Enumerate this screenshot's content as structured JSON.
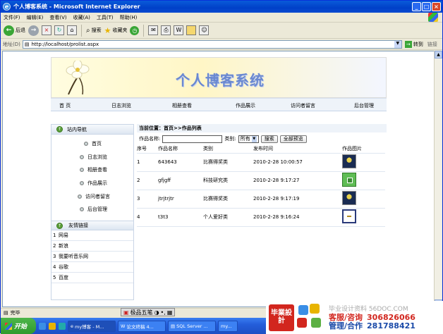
{
  "window": {
    "title": "个人博客系统 - Microsoft Internet Explorer",
    "min": "_",
    "max": "□",
    "close": "×"
  },
  "menu": [
    "文件(F)",
    "编辑(E)",
    "查看(V)",
    "收藏(A)",
    "工具(T)",
    "帮助(H)"
  ],
  "toolbar": {
    "back": "后退",
    "search": "搜索",
    "favorites": "收藏夹"
  },
  "address": {
    "label": "地址(D)",
    "url": "http://localhost/prolist.aspx",
    "go": "转到",
    "links": "链接"
  },
  "site": {
    "title": "个人博客系统",
    "nav": [
      "首 页",
      "日志浏览",
      "相册查看",
      "作品展示",
      "访问者留言",
      "后台管理"
    ],
    "sidebar": {
      "nav_title": "站内导航",
      "nav_items": [
        "首页",
        "日志浏览",
        "相册查看",
        "作品展示",
        "访问者留言",
        "后台管理"
      ],
      "links_title": "友情链接",
      "links": [
        {
          "n": "1",
          "name": "网易"
        },
        {
          "n": "2",
          "name": "新浪"
        },
        {
          "n": "3",
          "name": "我要听音乐网"
        },
        {
          "n": "4",
          "name": "谷歌"
        },
        {
          "n": "5",
          "name": "百度"
        }
      ]
    },
    "main": {
      "breadcrumb": "当前位置：首页>>作品列表",
      "search_label": "作品名称:",
      "category_label": "类别:",
      "category_selected": "所有",
      "search_button": "搜索",
      "all_button": "全部预览",
      "columns": [
        "序号",
        "作品名称",
        "类别",
        "发布时间",
        "作品图片"
      ],
      "rows": [
        {
          "no": "1",
          "name": "643643",
          "cat": "比赛得奖类",
          "time": "2010-2-28 10:00:57",
          "img": "t1"
        },
        {
          "no": "2",
          "name": "gfjgff",
          "cat": "科技研究类",
          "time": "2010-2-28 9:17:27",
          "img": "t2"
        },
        {
          "no": "3",
          "name": "jtrjtrjtr",
          "cat": "比赛得奖类",
          "time": "2010-2-28 9:17:19",
          "img": "t1"
        },
        {
          "no": "4",
          "name": "t3t3",
          "cat": "个人爱好类",
          "time": "2010-2-28 9:16:24",
          "img": "t3"
        }
      ]
    }
  },
  "status": {
    "text": "完毕",
    "ime": "极品五笔"
  },
  "taskbar": {
    "start": "开始",
    "tasks": [
      "my博客 - M...",
      "论文终稿 4...",
      "SQL Server ...",
      "my..."
    ]
  },
  "ad": {
    "logo": "毕業設計",
    "top": "毕业设计资料 56DOC.COM",
    "l1": "客服/咨询",
    "n1": "306826066",
    "l2": "管理/合作",
    "n2": "281788421"
  }
}
